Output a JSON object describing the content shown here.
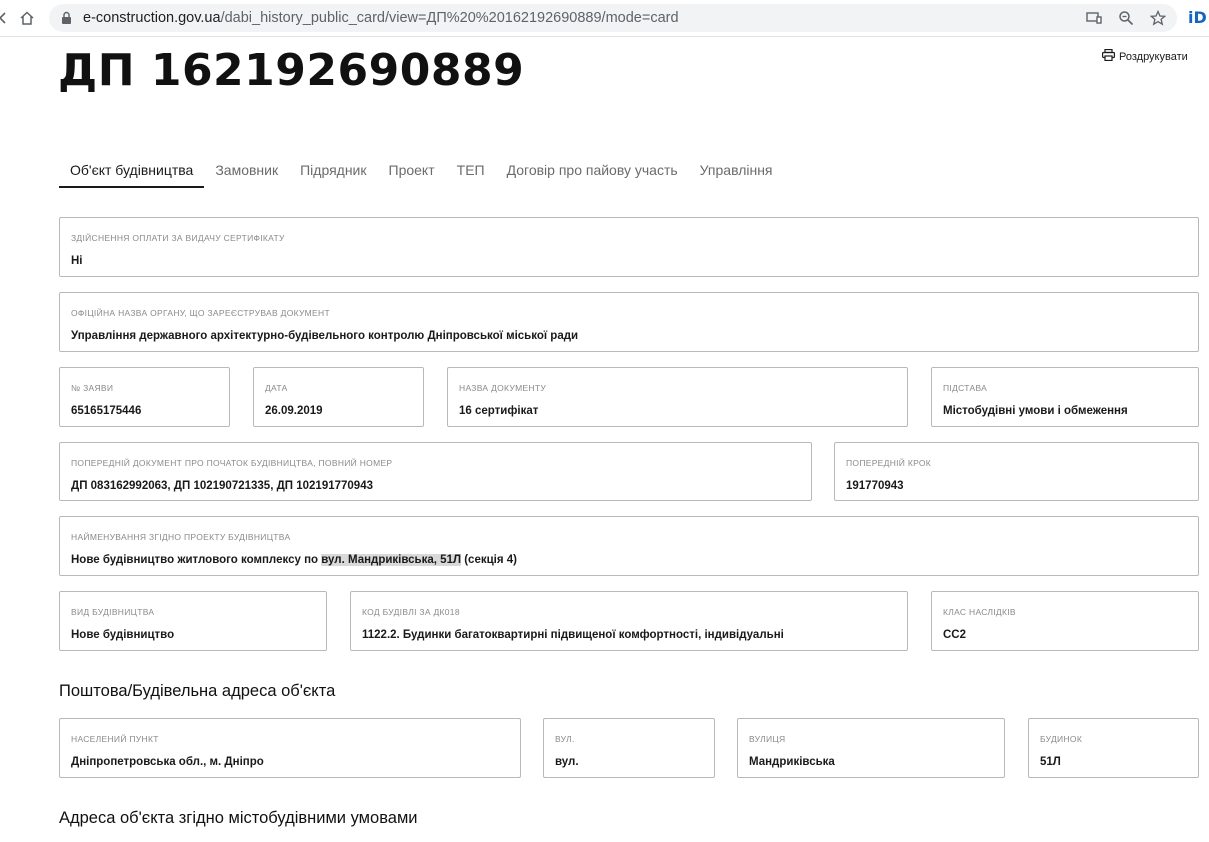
{
  "browser": {
    "url_host": "e-construction.gov.ua",
    "url_path": "/dabi_history_public_card/view=ДП%20%20162192690889/mode=card",
    "extension_label": "iD"
  },
  "page": {
    "print_label": "Роздрукувати",
    "title": "ДП 162192690889"
  },
  "tabs": [
    "Об'єкт будівництва",
    "Замовник",
    "Підрядник",
    "Проект",
    "ТЕП",
    "Договір про пайову участь",
    "Управління"
  ],
  "fields": {
    "payment": {
      "label": "Здійснення оплати за видачу сертифікату",
      "value": "Ні"
    },
    "organ": {
      "label": "Офіційна назва органу, що зареєстрував документ",
      "value": "Управління державного архітектурно-будівельного контролю Дніпровської міської ради"
    },
    "app_no": {
      "label": "№ заяви",
      "value": "65165175446"
    },
    "date": {
      "label": "Дата",
      "value": "26.09.2019"
    },
    "doc_name": {
      "label": "Назва документу",
      "value": "16 сертифікат"
    },
    "basis": {
      "label": "Підстава",
      "value": "Містобудівні умови і обмеження"
    },
    "prev_doc": {
      "label": "Попередній документ про початок будівництва, повний номер",
      "value": "ДП 083162992063, ДП 102190721335, ДП 102191770943"
    },
    "prev_step": {
      "label": "Попередній крок",
      "value": "191770943"
    },
    "name_project": {
      "label": "Найменування згідно проекту будівництва",
      "value_before": "Нове будівництво житлового комплексу по ",
      "value_highlight": "вул. Мандриківська, 51Л",
      "value_after": " (секція 4)"
    },
    "construction_type": {
      "label": "Вид будівництва",
      "value": "Нове будівництво"
    },
    "building_code": {
      "label": "Код будівлі за ДК018",
      "value": "1122.2. Будинки багатоквартирні підвищеної комфортності, індивідуальні"
    },
    "consequence_class": {
      "label": "Клас наслідків",
      "value": "СС2"
    }
  },
  "address_section": {
    "title": "Поштова/Будівельна адреса об'єкта",
    "settlement": {
      "label": "Населений пункт",
      "value": "Дніпропетровська обл., м. Дніпро"
    },
    "street_type": {
      "label": "Вул.",
      "value": "вул."
    },
    "street": {
      "label": "Вулиця",
      "value": "Мандриківська"
    },
    "house": {
      "label": "Будинок",
      "value": "51Л"
    }
  },
  "urban_section": {
    "title": "Адреса об'єкта згідно містобудівними умовами"
  },
  "colors": {
    "border": "#b9b9b9",
    "label": "#8a8a8a",
    "text": "#1a1a1a",
    "highlight": "#d9d9d9"
  }
}
